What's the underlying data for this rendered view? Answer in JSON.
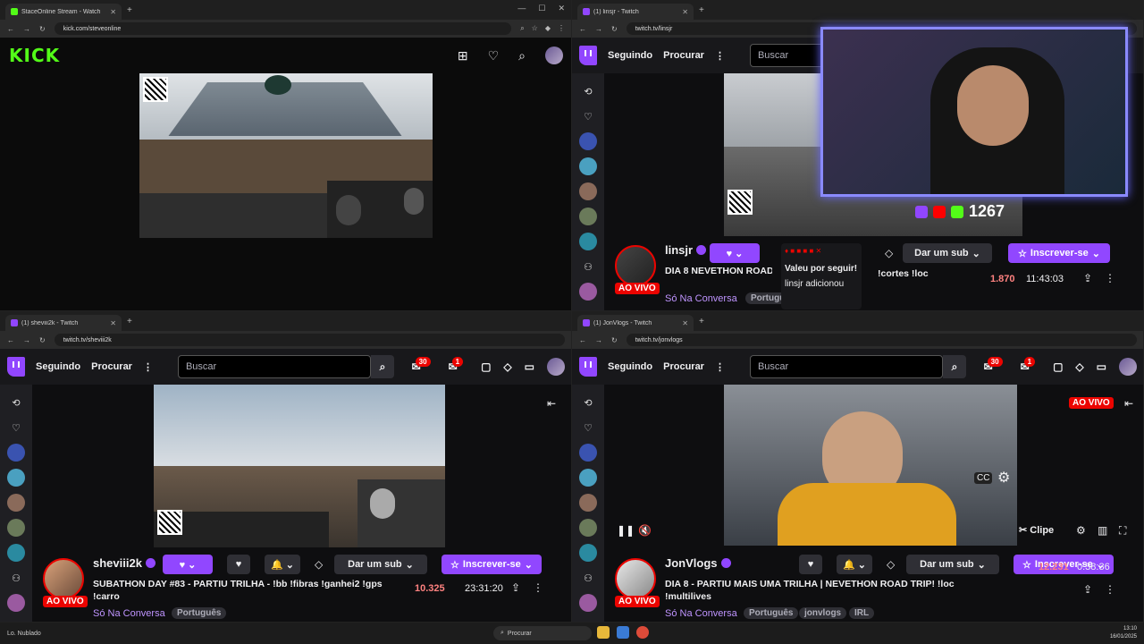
{
  "kick": {
    "tab_title": "StaceOnline Stream - Watch",
    "url": "kick.com/steveonline",
    "logo": "KICK"
  },
  "linsjr": {
    "tab_title": "(1) linsjr - Twitch",
    "url": "twitch.tv/linsjr",
    "nav_following": "Seguindo",
    "nav_browse": "Procurar",
    "search_placeholder": "Buscar",
    "channel": "linsjr",
    "title": "DIA 8 NEVETHON ROAD T",
    "category": "Só Na Conversa",
    "tag1": "Portuguê",
    "live": "AO VIVO",
    "viewers": "1.870",
    "uptime": "11:43:03",
    "sub_btn": "Dar um sub",
    "subscribe_btn": "Inscrever-se",
    "command": "!cortes !loc",
    "popup_title": "Valeu por seguir!",
    "popup_text": "linsjr adicionou",
    "counter": "1267"
  },
  "sheviii": {
    "tab_title": "(1) sheviii2k - Twitch",
    "url": "twitch.tv/sheviii2k",
    "nav_following": "Seguindo",
    "nav_browse": "Procurar",
    "search_placeholder": "Buscar",
    "notif_count": "30",
    "msg_count": "1",
    "channel": "sheviii2k",
    "title": "SUBATHON DAY #83 - PARTIU TRILHA - !bb !fibras !ganhei2 !gps !carro",
    "category": "Só Na Conversa",
    "tag1": "Português",
    "live": "AO VIVO",
    "viewers": "10.325",
    "uptime": "23:31:20",
    "sub_btn": "Dar um sub",
    "subscribe_btn": "Inscrever-se"
  },
  "jonvlogs": {
    "tab_title": "(1) JonVlogs - Twitch",
    "url": "twitch.tv/jonvlogs",
    "nav_following": "Seguindo",
    "nav_browse": "Procurar",
    "search_placeholder": "Buscar",
    "notif_count": "30",
    "msg_count": "1",
    "channel": "JonVlogs",
    "title": "DIA 8 - PARTIU MAIS UMA TRILHA | NEVETHON ROAD TRIP! !loc !multilives",
    "category": "Só Na Conversa",
    "tag1": "Português",
    "tag2": "jonvlogs",
    "tag3": "IRL",
    "live": "AO VIVO",
    "viewers": "12.231",
    "uptime": "0:38:36",
    "sub_btn": "Dar um sub",
    "subscribe_btn": "Inscrever-se",
    "clip_btn": "Clipe",
    "video_live": "AO VIVO"
  },
  "taskbar": {
    "weather": "Lo. Nublado",
    "search": "Procurar",
    "time": "13:10",
    "date": "16/01/2025"
  },
  "colors": {
    "twitch_purple": "#9147ff",
    "kick_green": "#53fc18",
    "live_red": "#eb0400"
  }
}
